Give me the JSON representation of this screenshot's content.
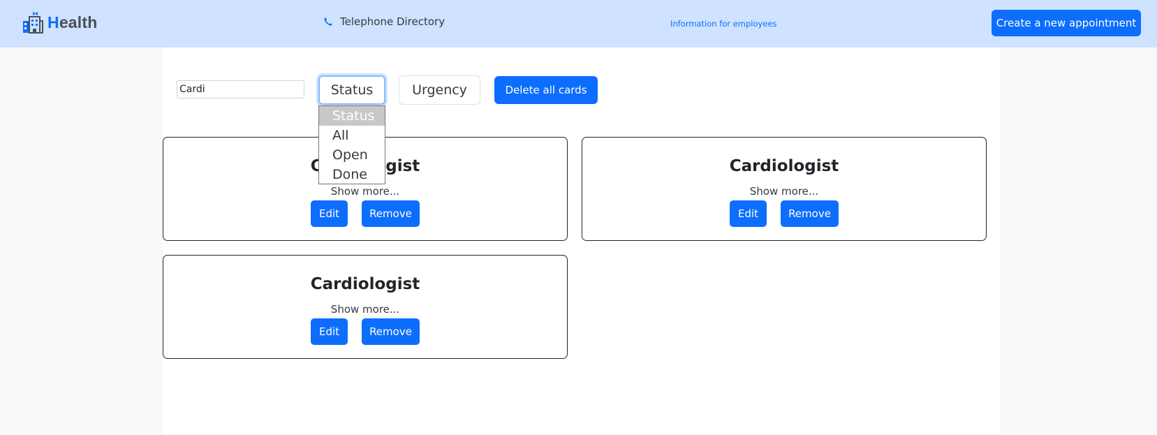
{
  "header": {
    "logo": {
      "prefix": "H",
      "rest": "ealth"
    },
    "phone_label": "Telephone Directory",
    "info_link": "Information for employees",
    "create_button": "Create a new appointment"
  },
  "filters": {
    "search_value": "Cardi",
    "status_label": "Status",
    "urgency_label": "Urgency",
    "delete_button": "Delete all cards",
    "status_options": [
      "Status",
      "All",
      "Open",
      "Done"
    ],
    "status_selected_index": 0
  },
  "cards": [
    {
      "title": "Cardiologist",
      "more": "Show more...",
      "edit": "Edit",
      "remove": "Remove"
    },
    {
      "title": "Cardiologist",
      "more": "Show more...",
      "edit": "Edit",
      "remove": "Remove"
    },
    {
      "title": "Cardiologist",
      "more": "Show more...",
      "edit": "Edit",
      "remove": "Remove"
    }
  ],
  "colors": {
    "header_bg": "#cfe2ff",
    "accent": "#0d6efd",
    "page_bg": "#f8f9fa"
  },
  "icons": [
    "hospital-icon",
    "phone-icon"
  ]
}
